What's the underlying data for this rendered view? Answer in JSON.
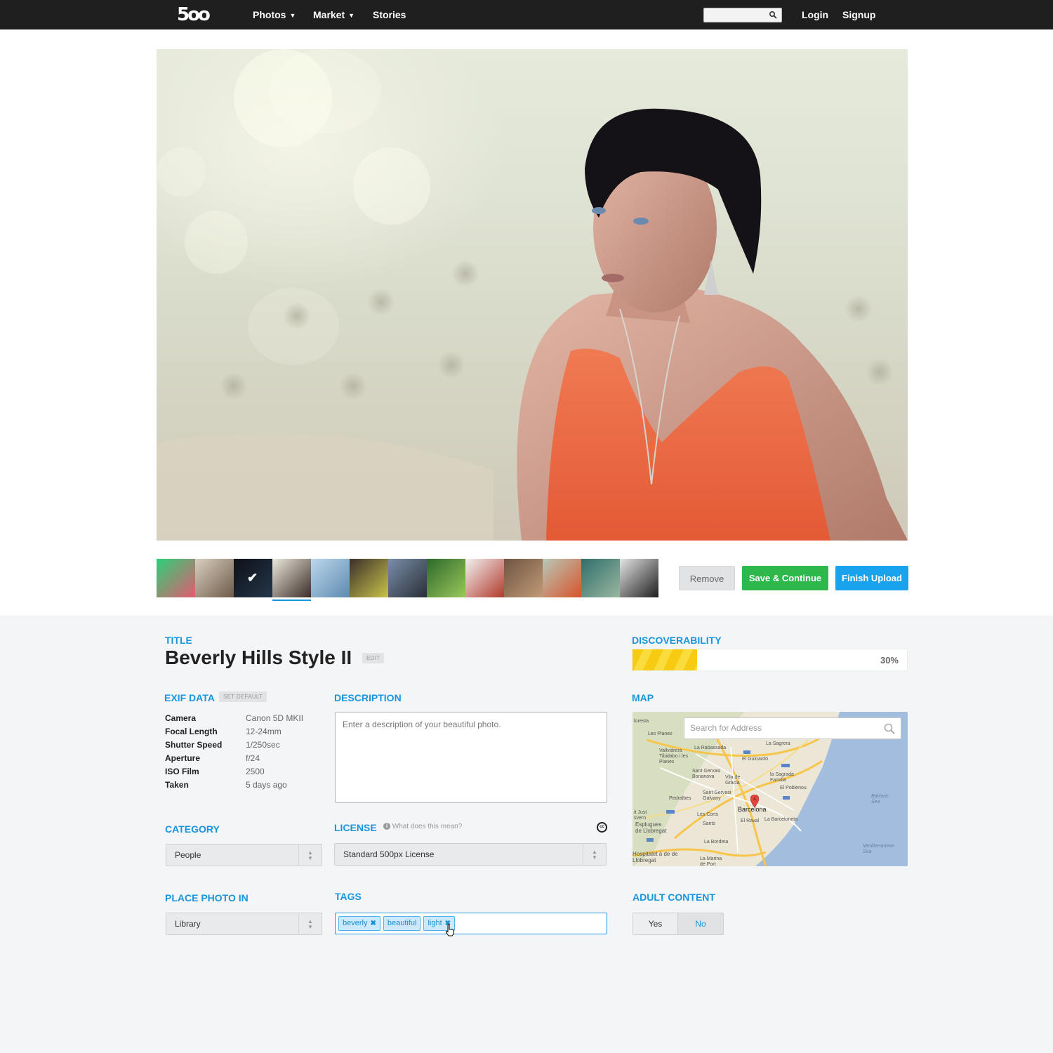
{
  "nav": {
    "logo": "5oo",
    "photos": "Photos",
    "market": "Market",
    "stories": "Stories",
    "login": "Login",
    "signup": "Signup",
    "search_placeholder": ""
  },
  "actions": {
    "remove": "Remove",
    "save": "Save & Continue",
    "finish": "Finish Upload"
  },
  "title": {
    "label": "TITLE",
    "value": "Beverly Hills Style II",
    "edit": "EDIT"
  },
  "exif": {
    "label": "EXIF DATA",
    "set_default": "SET DEFAULT",
    "rows": [
      {
        "key": "Camera",
        "value": "Canon 5D MKII"
      },
      {
        "key": "Focal Length",
        "value": "12-24mm"
      },
      {
        "key": "Shutter Speed",
        "value": "1/250sec"
      },
      {
        "key": "Aperture",
        "value": "f/24"
      },
      {
        "key": "ISO Film",
        "value": "2500"
      },
      {
        "key": "Taken",
        "value": "5 days ago"
      }
    ]
  },
  "description": {
    "label": "DESCRIPTION",
    "placeholder": "Enter a description of your beautiful photo."
  },
  "category": {
    "label": "CATEGORY",
    "value": "People"
  },
  "license": {
    "label": "LICENSE",
    "help": "What does this mean?",
    "value": "Standard 500px License",
    "cc_icon": "cc-icon"
  },
  "place": {
    "label": "PLACE PHOTO IN",
    "value": "Library"
  },
  "tags": {
    "label": "TAGS",
    "items": [
      "beverly",
      "beautiful",
      "light"
    ]
  },
  "discoverability": {
    "label": "DISCOVERABILITY",
    "percent_text": "30%",
    "value": 0.236,
    "color": "#f6cb12"
  },
  "map": {
    "label": "MAP",
    "search_placeholder": "Search for Address",
    "labels": {
      "loresta": "loresta",
      "les_planes": "Les Planes",
      "sagrera": "La Sagrera",
      "rabassada": "La Rabassada",
      "vallvidrera": "Vallvidrera Tibidabo i les Planes",
      "guinardo": "El Guinardó",
      "sant_gervasi": "Sant Gervasi Bonanova",
      "vila_gracia": "Vila de Gràcia",
      "sagrada_familia": "la Sagrada Família",
      "poblenou": "El Poblenou",
      "pedralbes": "Pedralbes",
      "sant_gervasi_galvany": "Sant Gervasi Galvany",
      "barcelona": "Barcelona",
      "balearic_sea": "Balearic Sea",
      "sant_just": "it Just svern",
      "les_corts": "Les Corts",
      "raval": "El Raval",
      "barceloneta": "La Barceloneta",
      "esplugues": "Esplugues de Llobregat",
      "sants": "Sants",
      "bordeta": "La Bordeta",
      "mediterranean": "Mediterranean Sea",
      "hospitalet": "Hospitalet à de de Llobregat",
      "marina": "La Marina de Port"
    }
  },
  "adult": {
    "label": "ADULT CONTENT",
    "yes": "Yes",
    "no": "No",
    "selected": "No"
  },
  "thumbnails": [
    {
      "colors": [
        "#2bd07a",
        "#e45a6e"
      ]
    },
    {
      "colors": [
        "#d9cfc0",
        "#6e5a48"
      ]
    },
    {
      "colors": [
        "#0e1018",
        "#25364a"
      ]
    },
    {
      "colors": [
        "#ece9dc",
        "#3b2c28"
      ]
    },
    {
      "colors": [
        "#bcd7ec",
        "#5d8ab0"
      ]
    },
    {
      "colors": [
        "#3b2f2a",
        "#c9c44a"
      ]
    },
    {
      "colors": [
        "#7a8ea8",
        "#2a2e38"
      ]
    },
    {
      "colors": [
        "#2c6a2a",
        "#9bc65b"
      ]
    },
    {
      "colors": [
        "#f2f2f2",
        "#b23a2c"
      ]
    },
    {
      "colors": [
        "#6d5542",
        "#c29a76"
      ]
    },
    {
      "colors": [
        "#b8c8b8",
        "#d8542a"
      ]
    },
    {
      "colors": [
        "#2f6f6a",
        "#9ab6a0"
      ]
    },
    {
      "colors": [
        "#e4e4e4",
        "#1e1e1e"
      ]
    }
  ]
}
